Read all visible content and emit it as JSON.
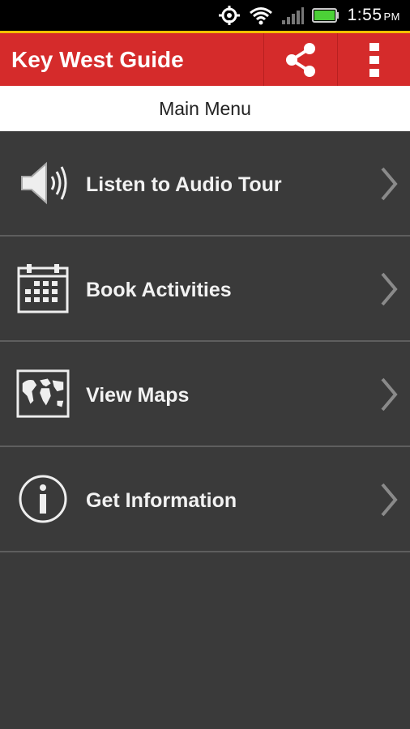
{
  "status_bar": {
    "time": "1:55",
    "ampm": "PM",
    "icons": [
      "gps-icon",
      "wifi-icon",
      "signal-icon",
      "battery-icon"
    ]
  },
  "app_bar": {
    "title": "Key West Guide",
    "actions": [
      "share-icon",
      "overflow-menu-icon"
    ],
    "color": "#d52b2b",
    "accent": "#f5c000"
  },
  "subheader": {
    "title": "Main Menu"
  },
  "menu": {
    "items": [
      {
        "label": "Listen to Audio Tour",
        "icon": "speaker-icon"
      },
      {
        "label": "Book Activities",
        "icon": "calendar-icon"
      },
      {
        "label": "View Maps",
        "icon": "map-icon"
      },
      {
        "label": "Get Information",
        "icon": "info-icon"
      }
    ]
  }
}
